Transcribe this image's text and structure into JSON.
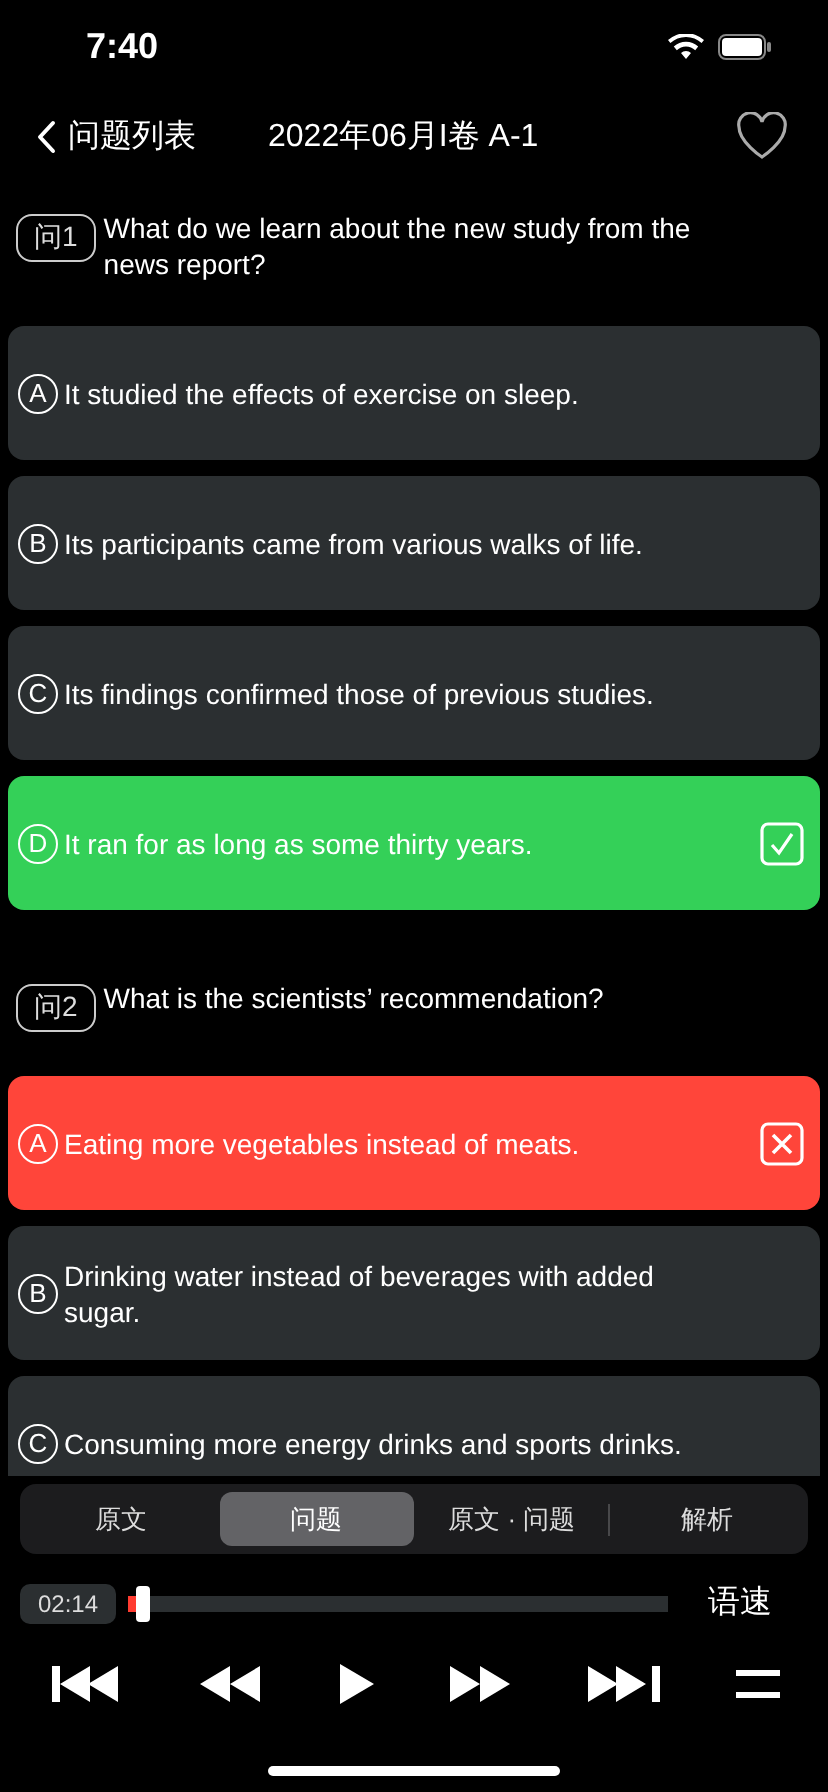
{
  "status_bar": {
    "time": "7:40"
  },
  "nav": {
    "back_label": "问题列表",
    "title": "2022年06月I卷 A-1",
    "favorite": false
  },
  "questions": [
    {
      "number": "问1",
      "text": "What do we learn about the new study from the news report?",
      "options": [
        {
          "letter": "A",
          "text": "It studied the effects of exercise on sleep.",
          "kind": "plain"
        },
        {
          "letter": "B",
          "text": "Its participants came from various walks of life.",
          "kind": "plain"
        },
        {
          "letter": "C",
          "text": "Its findings confirmed those of previous studies.",
          "kind": "plain"
        },
        {
          "letter": "D",
          "text": "It ran for as long as some thirty years.",
          "kind": "correct"
        }
      ]
    },
    {
      "number": "问2",
      "text": "What is the scientists’ recommendation?",
      "options": [
        {
          "letter": "A",
          "text": "Eating more vegetables instead of meats.",
          "kind": "wrong"
        },
        {
          "letter": "B",
          "text": "Drinking water instead of beverages with added sugar.",
          "kind": "plain"
        },
        {
          "letter": "C",
          "text": "Consuming more energy drinks and sports drinks.",
          "kind": "plain"
        }
      ]
    }
  ],
  "tabs": [
    {
      "label": "原文",
      "selected": false
    },
    {
      "label": "问题",
      "selected": true
    },
    {
      "label": "原文 · 问题",
      "selected": false
    },
    {
      "label": "解析",
      "selected": false
    }
  ],
  "player": {
    "time": "02:14",
    "level": 0.035,
    "speed_label": "语速"
  }
}
